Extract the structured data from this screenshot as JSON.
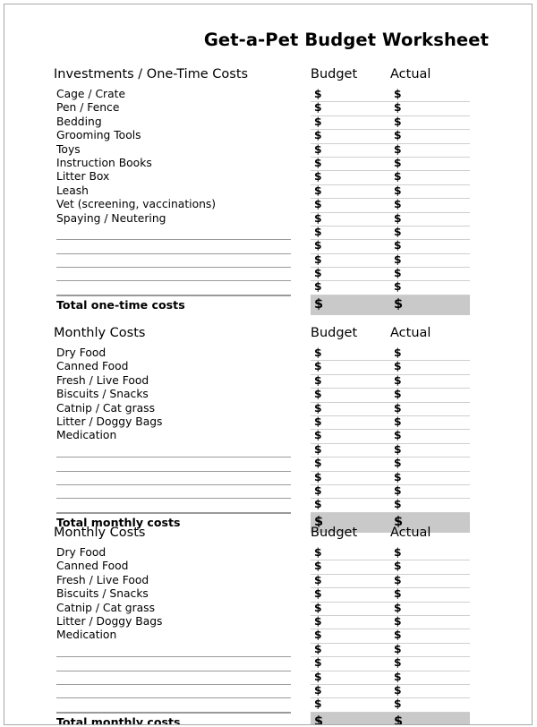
{
  "document": {
    "title": "Get-a-Pet Budget Worksheet",
    "currency_symbol": "$",
    "rule_color": "#9a9a9a",
    "total_band_color": "#c9c9c9",
    "page_border_color": "#a8a8a8"
  },
  "columns": {
    "budget_label": "Budget",
    "actual_label": "Actual"
  },
  "sections": [
    {
      "title": "Investments / One-Time Costs",
      "items": [
        "Cage / Crate",
        "Pen / Fence",
        "Bedding",
        "Grooming Tools",
        "Toys",
        "Instruction Books",
        "Litter Box",
        "Leash",
        "Vet (screening, vaccinations)",
        "Spaying / Neutering"
      ],
      "blank_rows": 5,
      "total_label": "Total one-time costs"
    },
    {
      "title": "Monthly Costs",
      "items": [
        "Dry Food",
        "Canned Food",
        "Fresh / Live Food",
        "Biscuits / Snacks",
        "Catnip / Cat grass",
        "Litter / Doggy Bags",
        "Medication"
      ],
      "blank_rows": 5,
      "total_label": "Total monthly costs"
    },
    {
      "title": "Monthly Costs",
      "items": [
        "Dry Food",
        "Canned Food",
        "Fresh / Live Food",
        "Biscuits / Snacks",
        "Catnip / Cat grass",
        "Litter / Doggy Bags",
        "Medication"
      ],
      "blank_rows": 5,
      "total_label": "Total monthly costs"
    }
  ]
}
